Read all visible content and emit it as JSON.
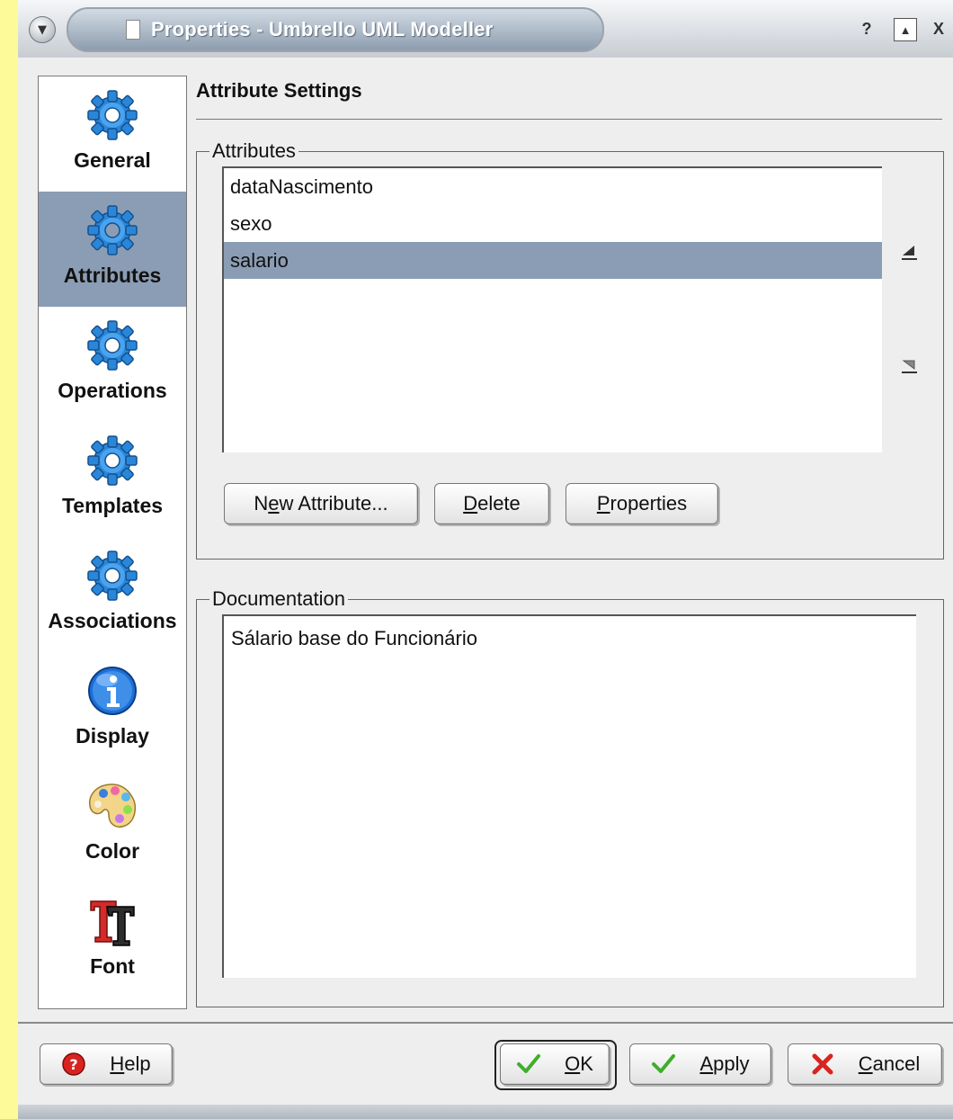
{
  "window": {
    "title": "Properties - Umbrello UML Modeller",
    "help_glyph": "?",
    "shade_glyph": "▲",
    "close_glyph": "X",
    "menu_glyph": "▼"
  },
  "sidebar": {
    "items": [
      {
        "label": "General",
        "icon": "gear-icon",
        "selected": false
      },
      {
        "label": "Attributes",
        "icon": "gear-icon",
        "selected": true
      },
      {
        "label": "Operations",
        "icon": "gear-icon",
        "selected": false
      },
      {
        "label": "Templates",
        "icon": "gear-icon",
        "selected": false
      },
      {
        "label": "Associations",
        "icon": "gear-icon",
        "selected": false
      },
      {
        "label": "Display",
        "icon": "info-icon",
        "selected": false
      },
      {
        "label": "Color",
        "icon": "palette-icon",
        "selected": false
      },
      {
        "label": "Font",
        "icon": "font-icon",
        "selected": false
      }
    ]
  },
  "main": {
    "section_title": "Attribute Settings",
    "attributes_group": {
      "legend": "Attributes",
      "items": [
        "dataNascimento",
        "sexo",
        "salario"
      ],
      "selected_index": 2
    },
    "buttons": {
      "new_attribute": {
        "pre": "N",
        "ul": "e",
        "post": "w Attribute..."
      },
      "delete": {
        "pre": "",
        "ul": "D",
        "post": "elete"
      },
      "properties": {
        "pre": "",
        "ul": "P",
        "post": "roperties"
      }
    },
    "documentation_group": {
      "legend": "Documentation",
      "text": "Sálario base do Funcionário"
    }
  },
  "footer": {
    "help": {
      "ul": "H",
      "post": "elp"
    },
    "ok": {
      "ul": "O",
      "post": "K"
    },
    "apply": {
      "ul": "A",
      "post": "pply"
    },
    "cancel": {
      "ul": "C",
      "post": "ancel"
    }
  },
  "colors": {
    "selection": "#8b9db4",
    "background_outside": "#fdfa9a",
    "dialog_bg": "#eeeeee"
  }
}
